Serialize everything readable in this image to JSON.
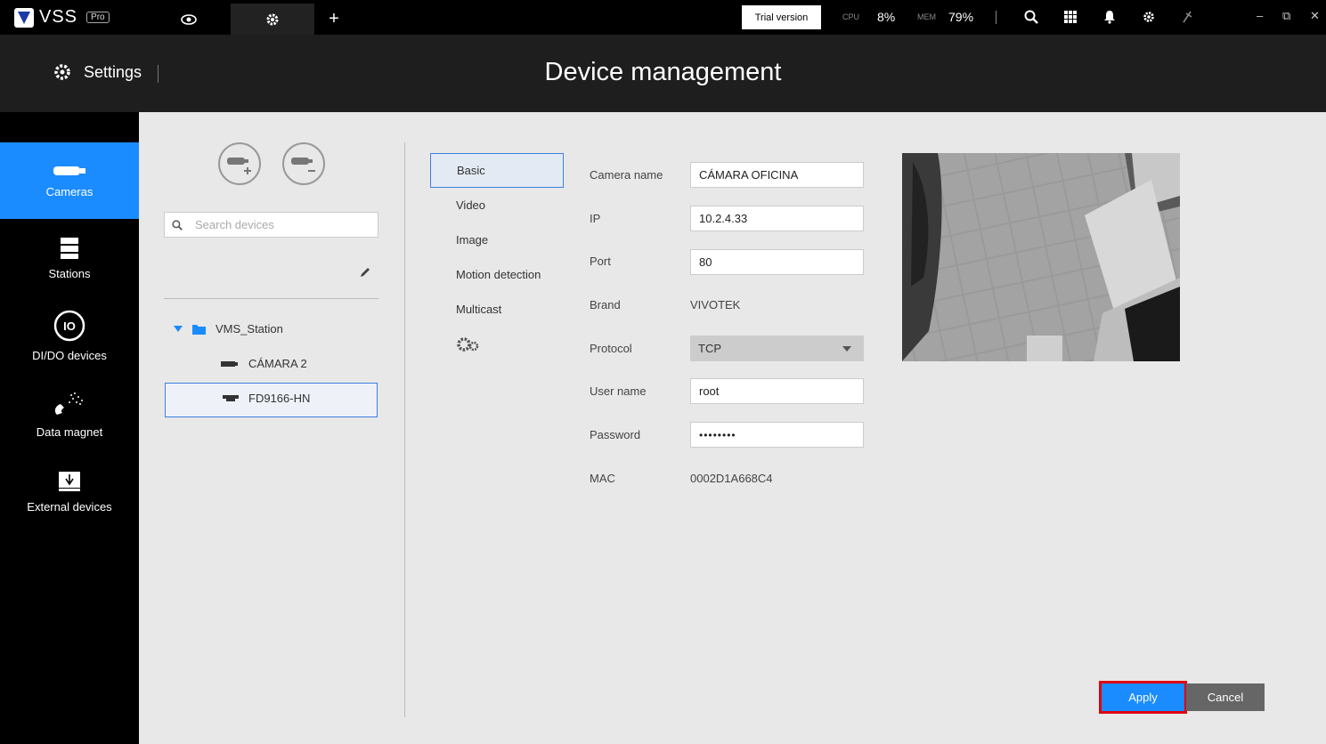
{
  "topbar": {
    "app_name": "VSS",
    "edition": "Pro",
    "trial_label": "Trial version",
    "cpu_label": "CPU",
    "cpu_value": "8%",
    "mem_label": "MEM",
    "mem_value": "79%",
    "tabs": [
      "eye-icon",
      "gear-icon",
      "plus-icon"
    ]
  },
  "header": {
    "section": "Settings",
    "title": "Device management"
  },
  "leftnav": {
    "items": [
      {
        "label": "Cameras",
        "icon": "camera-icon",
        "active": true
      },
      {
        "label": "Stations",
        "icon": "server-icon"
      },
      {
        "label": "DI/DO devices",
        "icon": "io-icon"
      },
      {
        "label": "Data magnet",
        "icon": "magnet-icon"
      },
      {
        "label": "External devices",
        "icon": "usb-drive-icon"
      }
    ]
  },
  "device_panel": {
    "search_placeholder": "Search devices",
    "tree": {
      "station": "VMS_Station",
      "cameras": [
        "CÁMARA 2",
        "FD9166-HN"
      ],
      "selected": "FD9166-HN"
    }
  },
  "subtabs": [
    "Basic",
    "Video",
    "Image",
    "Motion detection",
    "Multicast"
  ],
  "form": {
    "camera_name_label": "Camera name",
    "camera_name": "CÁMARA OFICINA",
    "ip_label": "IP",
    "ip": "10.2.4.33",
    "port_label": "Port",
    "port": "80",
    "brand_label": "Brand",
    "brand": "VIVOTEK",
    "protocol_label": "Protocol",
    "protocol": "TCP",
    "username_label": "User name",
    "username": "root",
    "password_label": "Password",
    "password": "••••••••",
    "mac_label": "MAC",
    "mac": "0002D1A668C4"
  },
  "actions": {
    "apply": "Apply",
    "cancel": "Cancel"
  },
  "colors": {
    "accent": "#1a8cff",
    "highlight": "#e00010"
  }
}
